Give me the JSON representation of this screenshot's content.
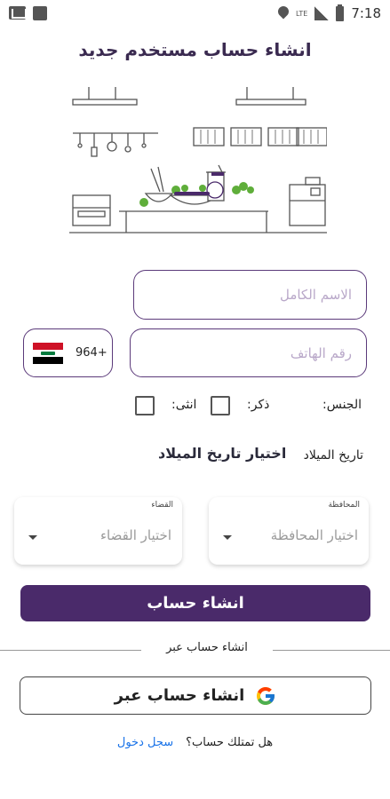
{
  "status_bar": {
    "time": "7:18",
    "network": "LTE",
    "icons": [
      "gmail-icon",
      "notification-square-icon",
      "location-icon",
      "signal-icon",
      "battery-icon"
    ]
  },
  "title": "انشاء حساب مستخدم جديد",
  "form": {
    "fullname_placeholder": "الاسم الكامل",
    "phone_placeholder": "رقم الهاتف",
    "country_code": "964+",
    "country_flag": "iraq-flag-icon",
    "gender_label": "الجنس:",
    "gender_male": "ذكر:",
    "gender_female": "انثى:",
    "birth_label": "تاريخ الميلاد",
    "birth_picker": "اختيار تاريخ الميلاد",
    "governorate_small_label": "المحافظة",
    "governorate_value": "اختيار المحافظة",
    "district_small_label": "القضاء",
    "district_value": "اختيار القضاء"
  },
  "create_button": "انشاء حساب",
  "divider_text": "انشاء حساب عبر",
  "google_button": "انشاء حساب عبر",
  "footer": {
    "question": "هل تمتلك حساب؟",
    "login_link": "سجل دخول"
  },
  "colors": {
    "brand_purple": "#4a2a6a",
    "border_purple": "#5b3a7a",
    "link_blue": "#1a73e8"
  }
}
